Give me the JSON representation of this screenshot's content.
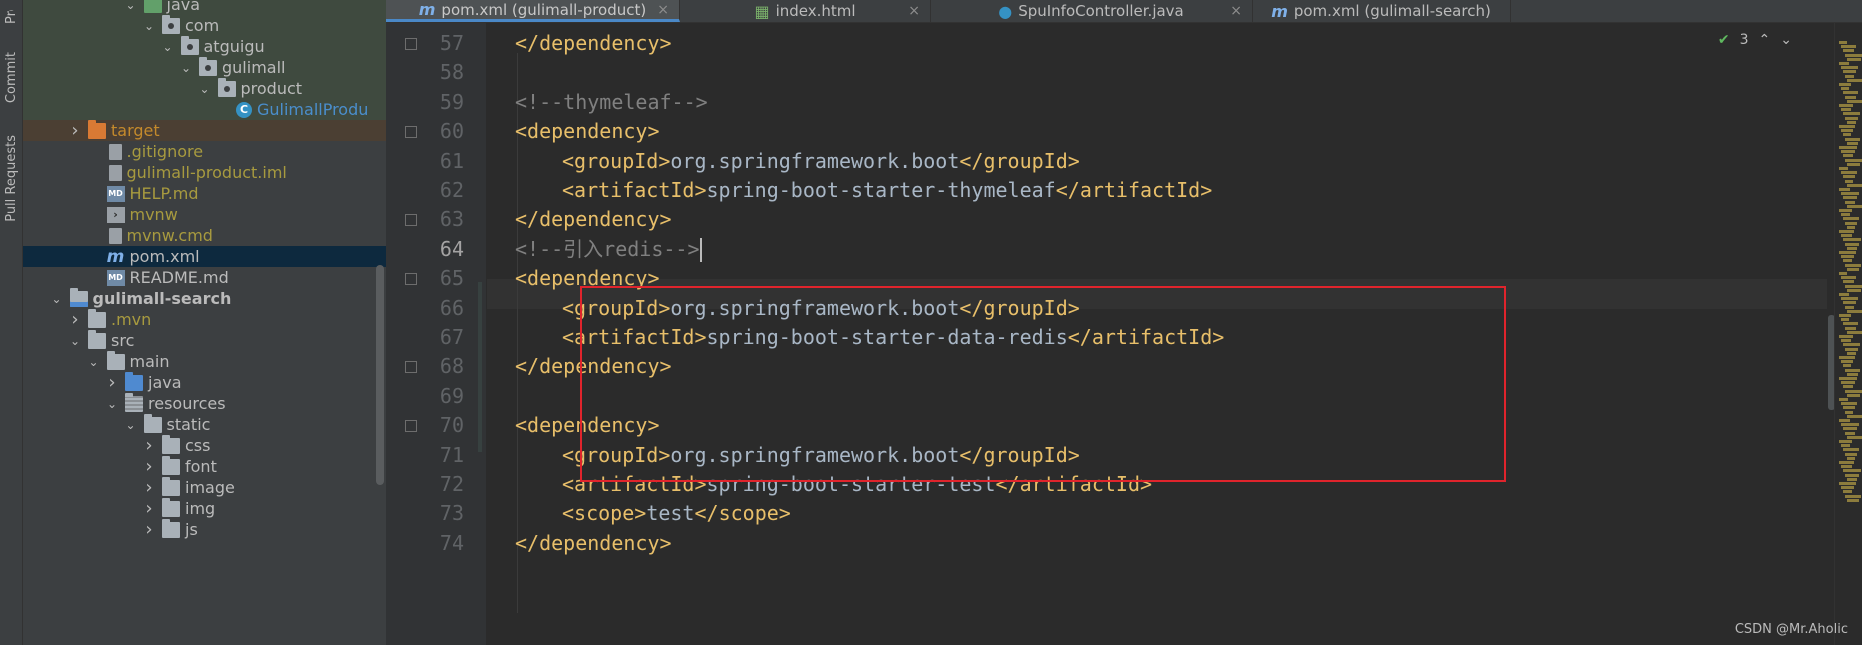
{
  "side_tabs": [
    "Project",
    "Commit",
    "Pull Requests"
  ],
  "tree": [
    {
      "label": "java",
      "indent": 5,
      "chev": "v",
      "icon": "folder-green",
      "color": "#bbbbbb"
    },
    {
      "label": "com",
      "indent": 6,
      "chev": "v",
      "icon": "folder-pkg",
      "color": "#bbbbbb"
    },
    {
      "label": "atguigu",
      "indent": 7,
      "chev": "v",
      "icon": "folder-pkg",
      "color": "#bbbbbb"
    },
    {
      "label": "gulimall",
      "indent": 8,
      "chev": "v",
      "icon": "folder-pkg",
      "color": "#bbbbbb"
    },
    {
      "label": "product",
      "indent": 9,
      "chev": "v",
      "icon": "folder-pkg",
      "color": "#bbbbbb"
    },
    {
      "label": "GulimallProdu",
      "indent": 10,
      "chev": "",
      "icon": "class",
      "color": "#4a8ecc"
    },
    {
      "label": "target",
      "indent": 2,
      "chev": ">",
      "icon": "folder-orange",
      "color": "#c48a2c"
    },
    {
      "label": ".gitignore",
      "indent": 3,
      "chev": "",
      "icon": "file",
      "color": "#a79a3f"
    },
    {
      "label": "gulimall-product.iml",
      "indent": 3,
      "chev": "",
      "icon": "file",
      "color": "#a79a3f"
    },
    {
      "label": "HELP.md",
      "indent": 3,
      "chev": "",
      "icon": "md",
      "color": "#a79a3f"
    },
    {
      "label": "mvnw",
      "indent": 3,
      "chev": "",
      "icon": "term",
      "color": "#a79a3f"
    },
    {
      "label": "mvnw.cmd",
      "indent": 3,
      "chev": "",
      "icon": "file",
      "color": "#a79a3f"
    },
    {
      "label": "pom.xml",
      "indent": 3,
      "chev": "",
      "icon": "m",
      "color": "#bbbbbb",
      "selected": true
    },
    {
      "label": "README.md",
      "indent": 3,
      "chev": "",
      "icon": "md",
      "color": "#bbbbbb"
    },
    {
      "label": "gulimall-search",
      "indent": 1,
      "chev": "v",
      "icon": "folder-module",
      "color": "#bbbbbb",
      "bold": true
    },
    {
      "label": ".mvn",
      "indent": 2,
      "chev": ">",
      "icon": "folder",
      "color": "#a79a3f"
    },
    {
      "label": "src",
      "indent": 2,
      "chev": "v",
      "icon": "folder",
      "color": "#bbbbbb"
    },
    {
      "label": "main",
      "indent": 3,
      "chev": "v",
      "icon": "folder",
      "color": "#bbbbbb"
    },
    {
      "label": "java",
      "indent": 4,
      "chev": ">",
      "icon": "folder-blue",
      "color": "#bbbbbb"
    },
    {
      "label": "resources",
      "indent": 4,
      "chev": "v",
      "icon": "folder-res",
      "color": "#bbbbbb"
    },
    {
      "label": "static",
      "indent": 5,
      "chev": "v",
      "icon": "folder",
      "color": "#bbbbbb"
    },
    {
      "label": "css",
      "indent": 6,
      "chev": ">",
      "icon": "folder",
      "color": "#bbbbbb"
    },
    {
      "label": "font",
      "indent": 6,
      "chev": ">",
      "icon": "folder",
      "color": "#bbbbbb"
    },
    {
      "label": "image",
      "indent": 6,
      "chev": ">",
      "icon": "folder",
      "color": "#bbbbbb"
    },
    {
      "label": "img",
      "indent": 6,
      "chev": ">",
      "icon": "folder",
      "color": "#bbbbbb"
    },
    {
      "label": "js",
      "indent": 6,
      "chev": ">",
      "icon": "folder",
      "color": "#bbbbbb"
    }
  ],
  "tabs": [
    {
      "label": "pom.xml (gulimall-product)",
      "icon": "m",
      "active": true
    },
    {
      "label": "index.html",
      "icon": "html",
      "active": false
    },
    {
      "label": "SpuInfoController.java",
      "icon": "class",
      "active": false
    },
    {
      "label": "pom.xml (gulimall-search)",
      "icon": "m",
      "active": false
    }
  ],
  "inspection_count": "3",
  "current_line": 64,
  "code_lines": [
    {
      "n": 57,
      "indent": 1,
      "parts": [
        [
          "br",
          "</"
        ],
        [
          "tg",
          "dependency"
        ],
        [
          "br",
          ">"
        ]
      ]
    },
    {
      "n": 58,
      "indent": 0,
      "parts": []
    },
    {
      "n": 59,
      "indent": 1,
      "parts": [
        [
          "cm",
          "<!--thymeleaf-->"
        ]
      ]
    },
    {
      "n": 60,
      "indent": 1,
      "parts": [
        [
          "br",
          "<"
        ],
        [
          "tg",
          "dependency"
        ],
        [
          "br",
          ">"
        ]
      ]
    },
    {
      "n": 61,
      "indent": 2,
      "parts": [
        [
          "br",
          "<"
        ],
        [
          "tg",
          "groupId"
        ],
        [
          "br",
          ">"
        ],
        [
          "txt",
          "org.springframework.boot"
        ],
        [
          "br",
          "</"
        ],
        [
          "tg",
          "groupId"
        ],
        [
          "br",
          ">"
        ]
      ]
    },
    {
      "n": 62,
      "indent": 2,
      "parts": [
        [
          "br",
          "<"
        ],
        [
          "tg",
          "artifactId"
        ],
        [
          "br",
          ">"
        ],
        [
          "txt",
          "spring-boot-starter-thymeleaf"
        ],
        [
          "br",
          "</"
        ],
        [
          "tg",
          "artifactId"
        ],
        [
          "br",
          ">"
        ]
      ]
    },
    {
      "n": 63,
      "indent": 1,
      "parts": [
        [
          "br",
          "</"
        ],
        [
          "tg",
          "dependency"
        ],
        [
          "br",
          ">"
        ]
      ]
    },
    {
      "n": 64,
      "indent": 1,
      "parts": [
        [
          "cm",
          "<!--引入redis-->"
        ]
      ],
      "caret": true
    },
    {
      "n": 65,
      "indent": 1,
      "parts": [
        [
          "br",
          "<"
        ],
        [
          "tg",
          "dependency"
        ],
        [
          "br",
          ">"
        ]
      ]
    },
    {
      "n": 66,
      "indent": 2,
      "parts": [
        [
          "br",
          "<"
        ],
        [
          "tg",
          "groupId"
        ],
        [
          "br",
          ">"
        ],
        [
          "txt",
          "org.springframework.boot"
        ],
        [
          "br",
          "</"
        ],
        [
          "tg",
          "groupId"
        ],
        [
          "br",
          ">"
        ]
      ]
    },
    {
      "n": 67,
      "indent": 2,
      "parts": [
        [
          "br",
          "<"
        ],
        [
          "tg",
          "artifactId"
        ],
        [
          "br",
          ">"
        ],
        [
          "txt",
          "spring-boot-starter-data-redis"
        ],
        [
          "br",
          "</"
        ],
        [
          "tg",
          "artifactId"
        ],
        [
          "br",
          ">"
        ]
      ]
    },
    {
      "n": 68,
      "indent": 1,
      "parts": [
        [
          "br",
          "</"
        ],
        [
          "tg",
          "dependency"
        ],
        [
          "br",
          ">"
        ]
      ]
    },
    {
      "n": 69,
      "indent": 0,
      "parts": []
    },
    {
      "n": 70,
      "indent": 1,
      "parts": [
        [
          "br",
          "<"
        ],
        [
          "tg",
          "dependency"
        ],
        [
          "br",
          ">"
        ]
      ]
    },
    {
      "n": 71,
      "indent": 2,
      "parts": [
        [
          "br",
          "<"
        ],
        [
          "tg",
          "groupId"
        ],
        [
          "br",
          ">"
        ],
        [
          "txt",
          "org.springframework.boot"
        ],
        [
          "br",
          "</"
        ],
        [
          "tg",
          "groupId"
        ],
        [
          "br",
          ">"
        ]
      ]
    },
    {
      "n": 72,
      "indent": 2,
      "parts": [
        [
          "br",
          "<"
        ],
        [
          "tg",
          "artifactId"
        ],
        [
          "br",
          ">"
        ],
        [
          "txt",
          "spring-boot-starter-test"
        ],
        [
          "br",
          "</"
        ],
        [
          "tg",
          "artifactId"
        ],
        [
          "br",
          ">"
        ]
      ]
    },
    {
      "n": 73,
      "indent": 2,
      "parts": [
        [
          "br",
          "<"
        ],
        [
          "tg",
          "scope"
        ],
        [
          "br",
          ">"
        ],
        [
          "txt",
          "test"
        ],
        [
          "br",
          "</"
        ],
        [
          "tg",
          "scope"
        ],
        [
          "br",
          ">"
        ]
      ]
    },
    {
      "n": 74,
      "indent": 1,
      "parts": [
        [
          "br",
          "</"
        ],
        [
          "tg",
          "dependency"
        ],
        [
          "br",
          ">"
        ]
      ]
    }
  ],
  "fold_lines": [
    57,
    60,
    63,
    65,
    68,
    70
  ],
  "watermark": "CSDN @Mr.Aholic",
  "colors": {
    "tag": "#e8bf6a",
    "text": "#a9b7c6",
    "comment": "#808080",
    "highlight": "#e0242c",
    "accent": "#4a88c7"
  }
}
